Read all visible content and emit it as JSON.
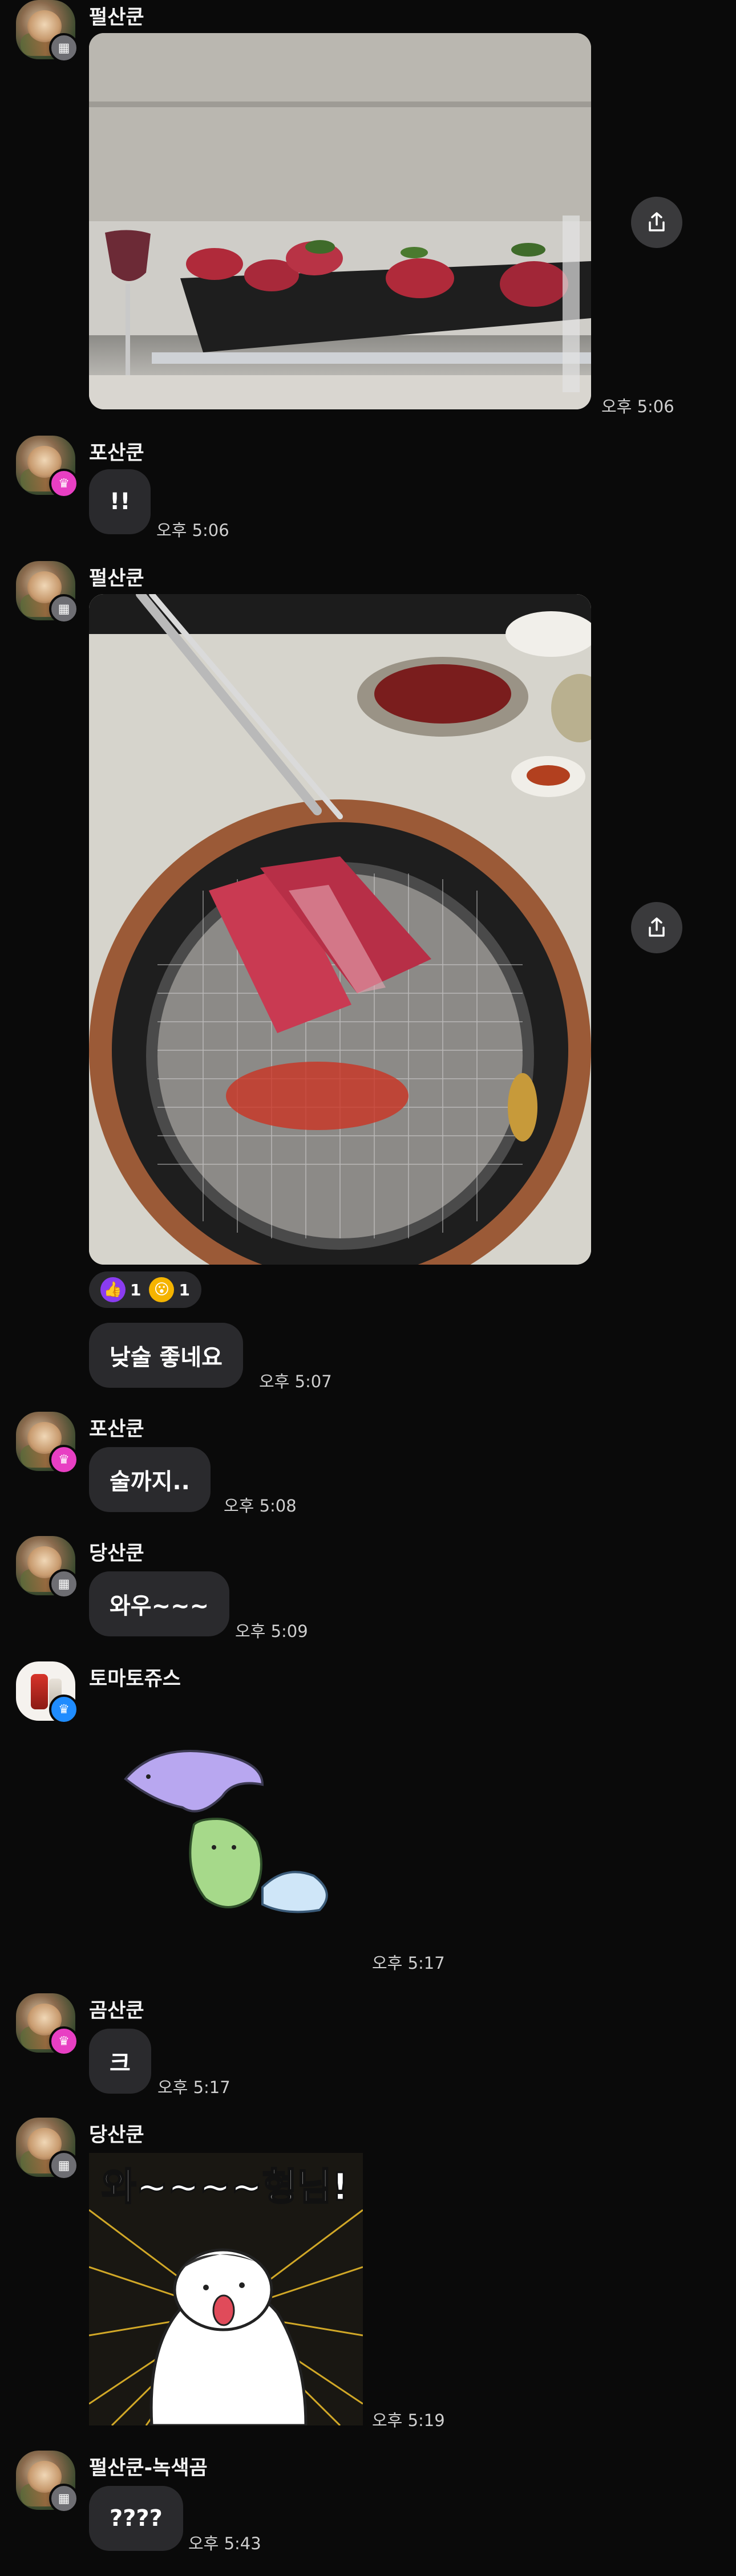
{
  "messages": [
    {
      "sender": "펄산쿤",
      "time": "오후 5:06"
    },
    {
      "sender": "포산쿤",
      "text": "!!",
      "time": "오후 5:06"
    },
    {
      "sender": "펄산쿤"
    },
    {
      "text": "낮술 좋네요",
      "time": "오후 5:07"
    },
    {
      "sender": "포산쿤",
      "text": "술까지..",
      "time": "오후 5:08"
    },
    {
      "sender": "당산쿤",
      "text": "와우~~~",
      "time": "오후 5:09"
    },
    {
      "sender": "토마토쥬스",
      "time": "오후 5:17"
    },
    {
      "sender": "곰산쿤",
      "text": "크",
      "time": "오후 5:17"
    },
    {
      "sender": "당산쿤",
      "time": "오후 5:19"
    },
    {
      "sender": "펄산쿤-녹색곰",
      "text": "????",
      "time": "오후 5:43"
    }
  ],
  "reactions": [
    {
      "icon": "thumbs-up-icon",
      "count": "1"
    },
    {
      "icon": "surprised-face-icon",
      "count": "1"
    }
  ],
  "sticker2_text": "와~~~~형님!",
  "colors": {
    "background": "#0a0a0a",
    "bubble": "#2a2a2d",
    "badge_pink": "#e83fc3",
    "badge_gray": "#6e6e73",
    "badge_blue": "#1f8cff"
  }
}
